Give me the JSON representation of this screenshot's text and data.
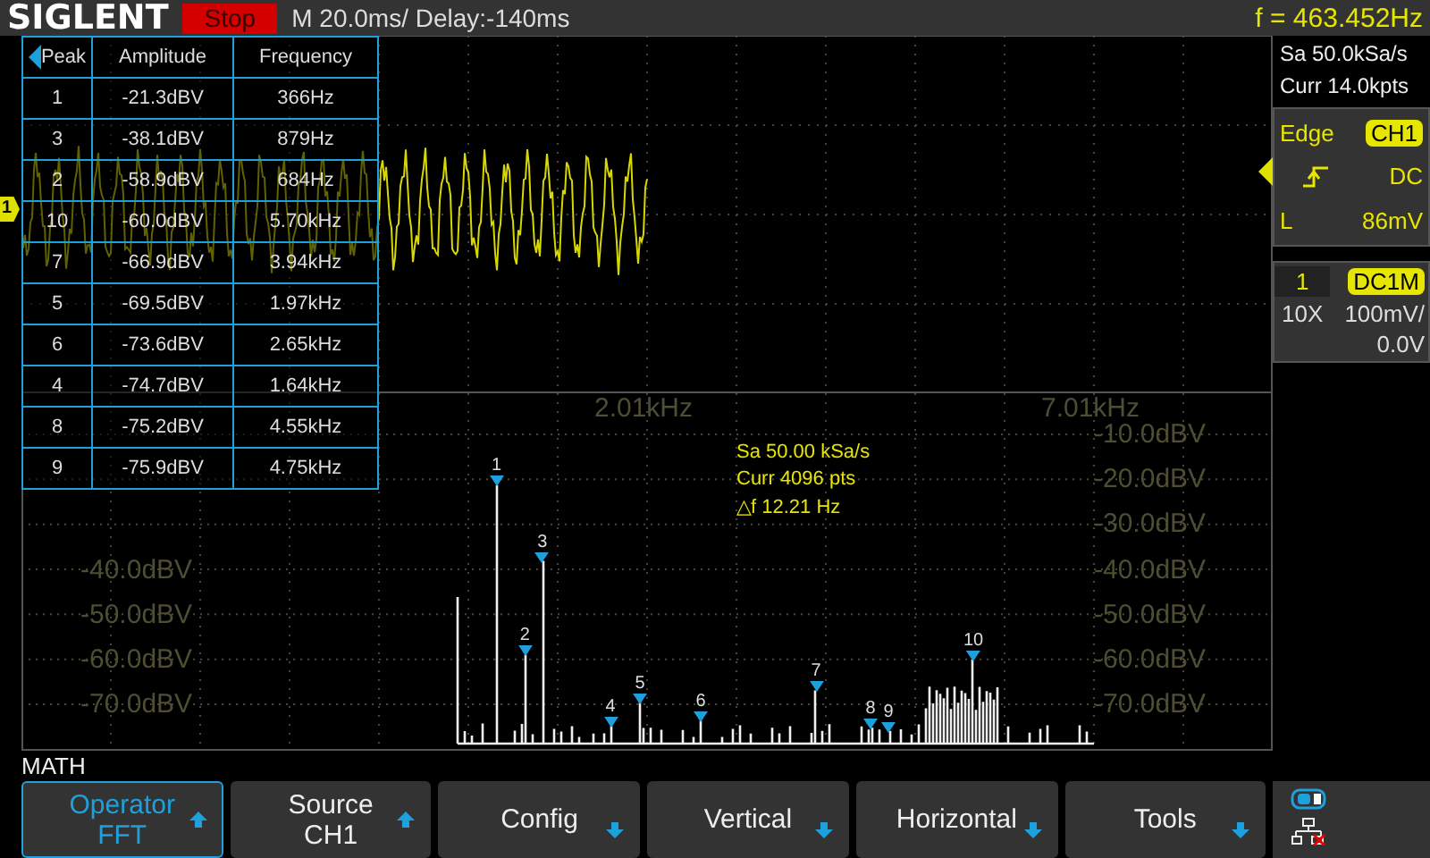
{
  "top_bar": {
    "logo": "SIGLENT",
    "run_state": "Stop",
    "timebase": "M 20.0ms/ Delay:-140ms",
    "frequency": "f = 463.452Hz"
  },
  "channel_marker": "1",
  "peak_table": {
    "columns": [
      "Peak",
      "Amplitude",
      "Frequency"
    ],
    "rows": [
      {
        "peak": "1",
        "amplitude": "-21.3dBV",
        "frequency": "366Hz"
      },
      {
        "peak": "3",
        "amplitude": "-38.1dBV",
        "frequency": "879Hz"
      },
      {
        "peak": "2",
        "amplitude": "-58.9dBV",
        "frequency": "684Hz"
      },
      {
        "peak": "10",
        "amplitude": "-60.0dBV",
        "frequency": "5.70kHz"
      },
      {
        "peak": "7",
        "amplitude": "-66.9dBV",
        "frequency": "3.94kHz"
      },
      {
        "peak": "5",
        "amplitude": "-69.5dBV",
        "frequency": "1.97kHz"
      },
      {
        "peak": "6",
        "amplitude": "-73.6dBV",
        "frequency": "2.65kHz"
      },
      {
        "peak": "4",
        "amplitude": "-74.7dBV",
        "frequency": "1.64kHz"
      },
      {
        "peak": "8",
        "amplitude": "-75.2dBV",
        "frequency": "4.55kHz"
      },
      {
        "peak": "9",
        "amplitude": "-75.9dBV",
        "frequency": "4.75kHz"
      }
    ]
  },
  "fft": {
    "info": [
      "Sa 50.00 kSa/s",
      "Curr 4096 pts",
      "△f 12.21 Hz"
    ],
    "markers": [
      "1",
      "2",
      "3",
      "4",
      "5",
      "6",
      "7",
      "8",
      "9",
      "10"
    ],
    "x_labels": [
      "2.01kHz",
      "7.01kHz"
    ],
    "y_labels_left": [
      "-40.0dBV",
      "-50.0dBV",
      "-60.0dBV",
      "-70.0dBV"
    ],
    "y_labels_right": [
      "-10.0dBV",
      "-20.0dBV",
      "-30.0dBV",
      "-40.0dBV",
      "-50.0dBV",
      "-60.0dBV",
      "-70.0dBV"
    ]
  },
  "acquisition": {
    "sample_rate": "Sa 50.0kSa/s",
    "memory": "Curr 14.0kpts"
  },
  "trigger": {
    "type": "Edge",
    "source": "CH1",
    "coupling": "DC",
    "level_label": "L",
    "level_value": "86mV"
  },
  "channel": {
    "number": "1",
    "coupling": "DC1M",
    "probe": "10X",
    "scale": "100mV/",
    "offset": "0.0V"
  },
  "math_label": "MATH",
  "menu": [
    {
      "label": "Operator",
      "value": "FFT",
      "kind": "up",
      "selected": true
    },
    {
      "label": "Source",
      "value": "CH1",
      "kind": "up",
      "selected": false
    },
    {
      "label": "Config",
      "kind": "down",
      "selected": false
    },
    {
      "label": "Vertical",
      "kind": "down",
      "selected": false
    },
    {
      "label": "Horizontal",
      "kind": "down",
      "selected": false
    },
    {
      "label": "Tools",
      "kind": "down",
      "selected": false
    }
  ]
}
